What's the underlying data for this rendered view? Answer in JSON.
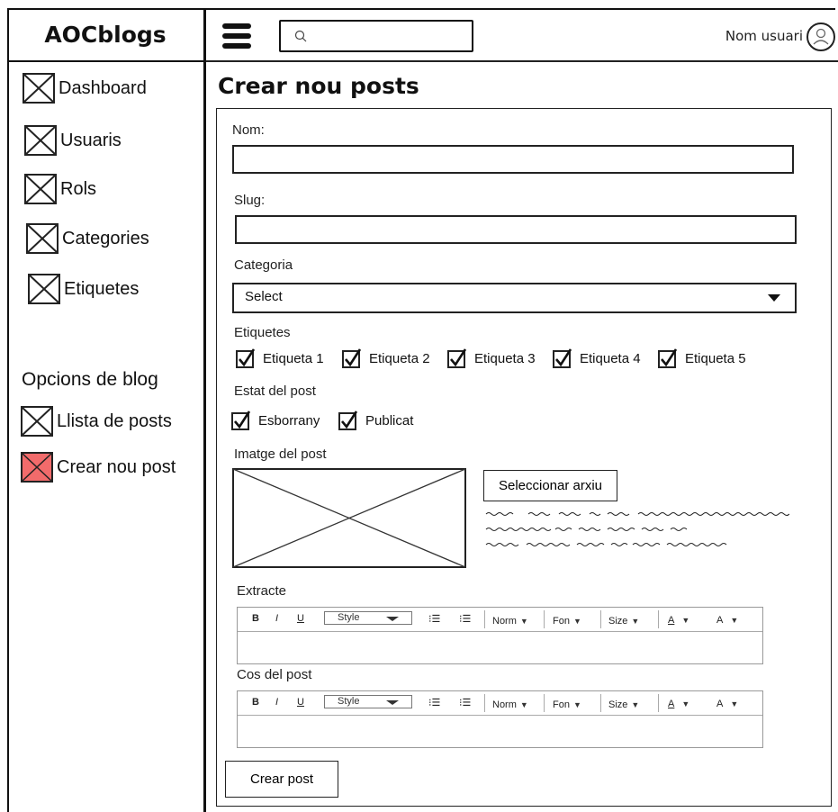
{
  "brand": "AOCblogs",
  "header": {
    "search_placeholder": "",
    "username": "Nom usuari"
  },
  "sidebar": {
    "items": [
      {
        "label": "Dashboard"
      },
      {
        "label": "Usuaris"
      },
      {
        "label": "Rols"
      },
      {
        "label": "Categories"
      },
      {
        "label": "Etiquetes"
      }
    ],
    "section_title": "Opcions de blog",
    "blog_items": [
      {
        "label": "Llista de posts",
        "active": false
      },
      {
        "label": "Crear nou post",
        "active": true
      }
    ],
    "active_color": "#f26b6b"
  },
  "main": {
    "title": "Crear nou posts",
    "form": {
      "name_label": "Nom:",
      "slug_label": "Slug:",
      "category_label": "Categoria",
      "category_value": "Select",
      "tags_label": "Etiquetes",
      "tags": [
        {
          "label": "Etiqueta 1",
          "checked": true
        },
        {
          "label": "Etiqueta 2",
          "checked": true
        },
        {
          "label": "Etiqueta 3",
          "checked": true
        },
        {
          "label": "Etiqueta 4",
          "checked": true
        },
        {
          "label": "Etiqueta 5",
          "checked": true
        }
      ],
      "status_label": "Estat del post",
      "statuses": [
        {
          "label": "Esborrany",
          "checked": true
        },
        {
          "label": "Publicat",
          "checked": true
        }
      ],
      "image_label": "Imatge del post",
      "select_file_label": "Seleccionar arxiu",
      "excerpt_label": "Extracte",
      "body_label": "Cos del post",
      "toolbar": {
        "bold": "B",
        "italic": "I",
        "underline": "U",
        "style": "Style",
        "font_size": "Norm",
        "font": "Fon",
        "size": "Size",
        "color": "A",
        "bg_color": "A"
      },
      "submit_label": "Crear post"
    }
  }
}
